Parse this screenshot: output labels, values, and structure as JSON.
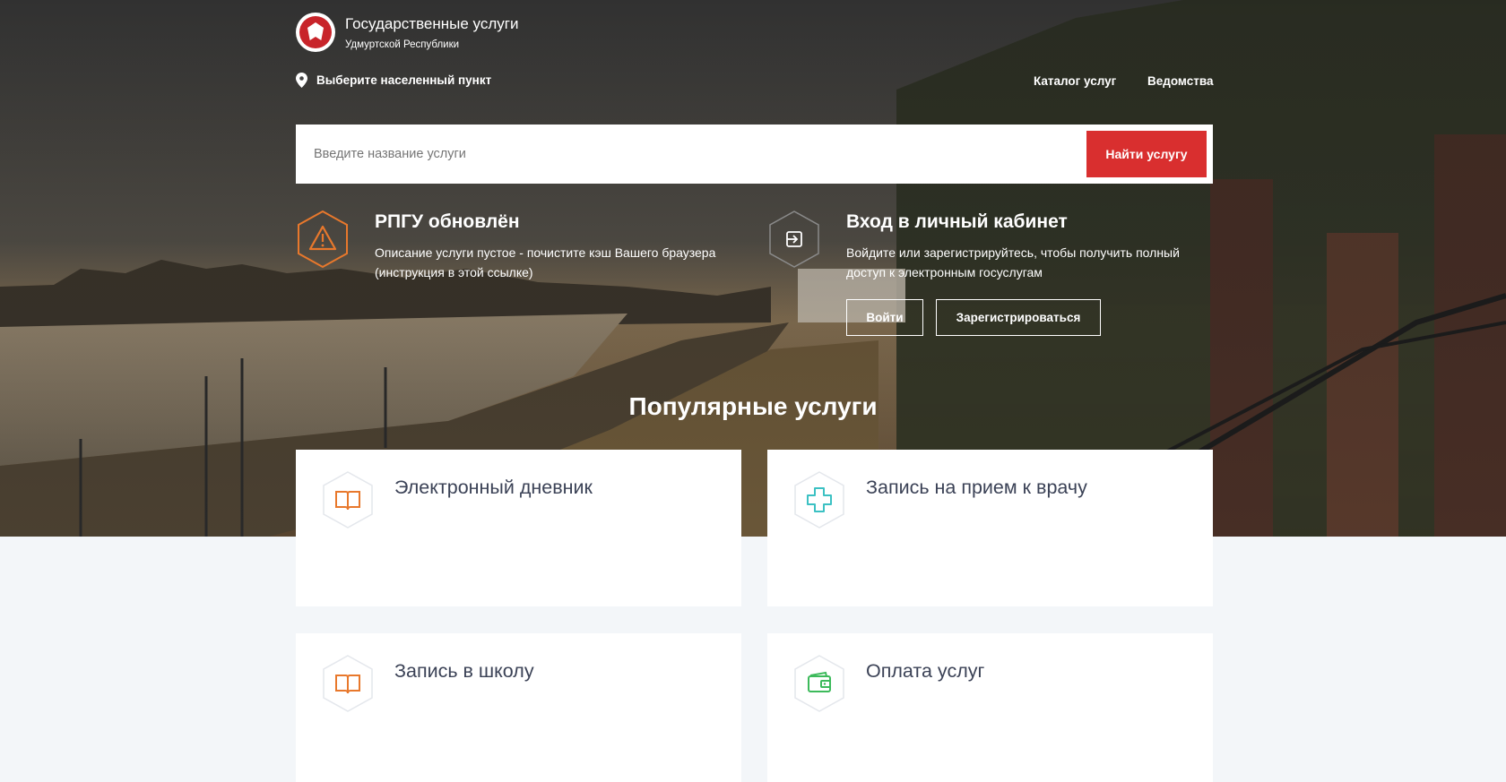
{
  "header": {
    "brand_title": "Государственные услуги",
    "brand_subtitle": "Удмуртской Республики",
    "location_label": "Выберите населенный пункт",
    "nav": [
      {
        "label": "Каталог услуг"
      },
      {
        "label": "Ведомства"
      }
    ]
  },
  "search": {
    "placeholder": "Введите название услуги",
    "button_label": "Найти услугу"
  },
  "notice": {
    "title": "РПГУ обновлён",
    "text_line1": "Описание услуги пустое - почистите кэш Вашего браузера",
    "text_line2": "(инструкция в этой ссылке)"
  },
  "login": {
    "title": "Вход в личный кабинет",
    "text_line1": "Войдите или зарегистрируйтесь, чтобы получить полный",
    "text_line2": "доступ к электронным госуслугам",
    "login_button": "Войти",
    "register_button": "Зарегистрироваться"
  },
  "popular": {
    "title": "Популярные услуги",
    "cards": [
      {
        "title": "Электронный дневник",
        "icon": "book-icon"
      },
      {
        "title": "Запись на прием к врачу",
        "icon": "medical-cross-icon"
      },
      {
        "title": "Запись в школу",
        "icon": "book-icon"
      },
      {
        "title": "Оплата услуг",
        "icon": "wallet-icon"
      }
    ]
  },
  "colors": {
    "accent_red": "#d92f2f",
    "warning_orange": "#e8782c",
    "medical_teal": "#3cc1c3",
    "wallet_green": "#3dba5b",
    "card_text": "#3b4256",
    "page_bg": "#f3f6f9"
  }
}
